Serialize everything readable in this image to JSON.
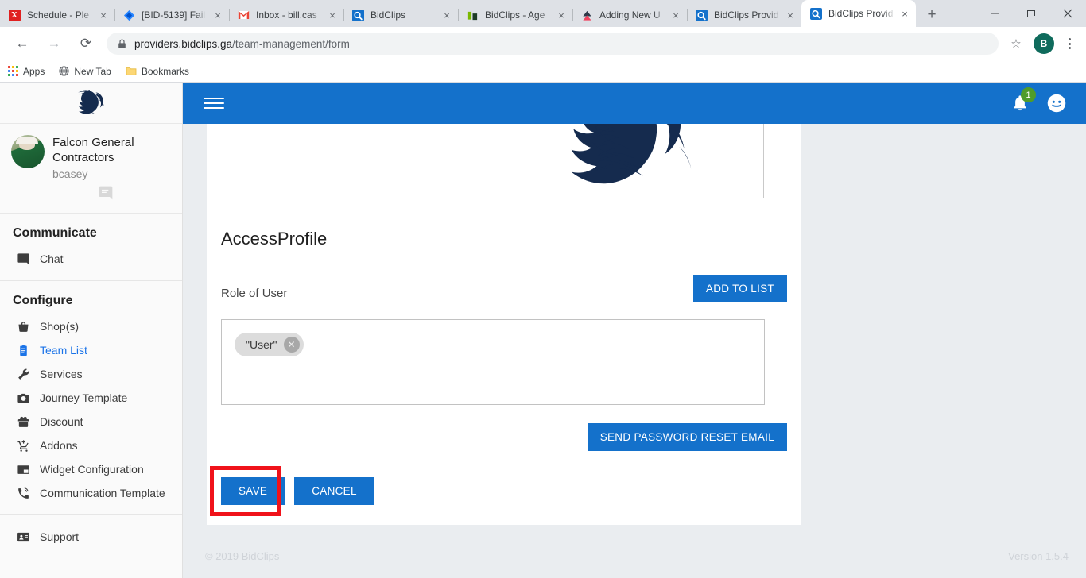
{
  "browser": {
    "tabs": [
      {
        "title": "Schedule - Ple",
        "favicon": "jira-x-icon",
        "active": false
      },
      {
        "title": "[BID-5139] Fail",
        "favicon": "jira-diamond-icon",
        "active": false
      },
      {
        "title": "Inbox - bill.cas",
        "favicon": "gmail-icon",
        "active": false
      },
      {
        "title": "BidClips",
        "favicon": "bidclips-icon",
        "active": false
      },
      {
        "title": "BidClips - Age",
        "favicon": "bidclips-green-icon",
        "active": false
      },
      {
        "title": "Adding New U",
        "favicon": "red-triangle-icon",
        "active": false
      },
      {
        "title": "BidClips Provid",
        "favicon": "bidclips-icon",
        "active": false
      },
      {
        "title": "BidClips Provid",
        "favicon": "bidclips-icon",
        "active": true
      }
    ],
    "new_tab_label": "+",
    "close_label": "×",
    "window_controls": {
      "minimize": "─",
      "maximize": "❐",
      "close": "✕"
    },
    "nav": {
      "back": "←",
      "forward": "→",
      "reload": "⟳"
    },
    "url": {
      "host": "providers.bidclips.ga",
      "path": "/team-management/form"
    },
    "star_label": "☆",
    "profile_initial": "B",
    "bookmarks": [
      {
        "label": "Apps",
        "icon": "apps-grid-icon"
      },
      {
        "label": "New Tab",
        "icon": "globe-icon"
      },
      {
        "label": "Bookmarks",
        "icon": "folder-icon"
      }
    ]
  },
  "sidebar": {
    "logo_name": "falcon-logo",
    "profile": {
      "name": "Falcon General Contractors",
      "username": "bcasey",
      "chat_icon": "chat-bubble-icon"
    },
    "sections": [
      {
        "title": "Communicate",
        "items": [
          {
            "label": "Chat",
            "icon": "chat-icon",
            "active": false
          }
        ]
      },
      {
        "title": "Configure",
        "items": [
          {
            "label": "Shop(s)",
            "icon": "basket-icon",
            "active": false
          },
          {
            "label": "Team List",
            "icon": "clipboard-icon",
            "active": true
          },
          {
            "label": "Services",
            "icon": "wrench-icon",
            "active": false
          },
          {
            "label": "Journey Template",
            "icon": "camera-icon",
            "active": false
          },
          {
            "label": "Discount",
            "icon": "gift-icon",
            "active": false
          },
          {
            "label": "Addons",
            "icon": "cart-plus-icon",
            "active": false
          },
          {
            "label": "Widget Configuration",
            "icon": "widget-icon",
            "active": false
          },
          {
            "label": "Communication Template",
            "icon": "phone-ring-icon",
            "active": false
          }
        ]
      }
    ],
    "bottom_items": [
      {
        "label": "Support",
        "icon": "contact-card-icon",
        "active": false
      }
    ]
  },
  "appbar": {
    "menu_icon": "hamburger-icon",
    "notification_icon": "bell-icon",
    "notification_count": "1",
    "account_icon": "account-circle-icon",
    "accent_color": "#1471cb",
    "badge_color": "#4f9c2b"
  },
  "main": {
    "logo_alt": "falcon-head-logo",
    "section_title": "AccessProfile",
    "add_to_list_label": "ADD TO LIST",
    "role_label": "Role of User",
    "role_chips": [
      {
        "label": "\"User\"",
        "remove_label": "✕"
      }
    ],
    "send_reset_label": "SEND PASSWORD RESET EMAIL",
    "save_label": "SAVE",
    "cancel_label": "CANCEL",
    "highlight_color": "#f0121a"
  },
  "footer": {
    "copyright": "© 2019 BidClips",
    "version": "Version 1.5.4"
  }
}
